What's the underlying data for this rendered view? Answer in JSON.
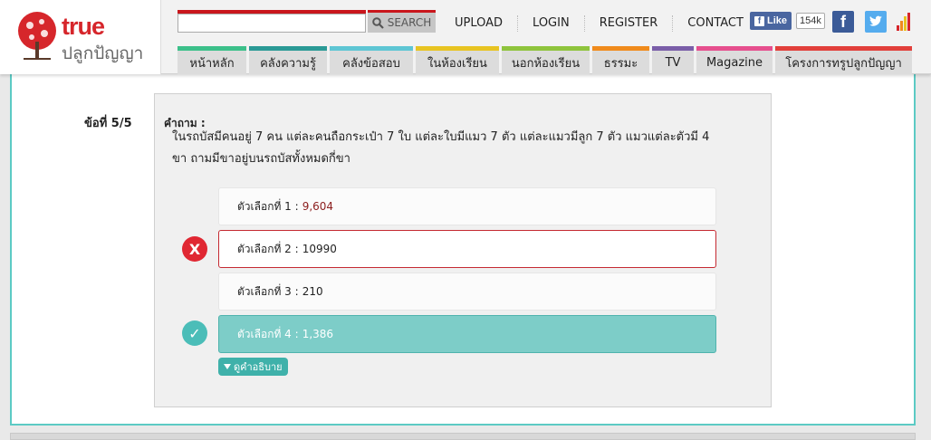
{
  "brand": {
    "name": "true",
    "tagline": "ปลูกปัญญา"
  },
  "search": {
    "placeholder": "",
    "button_label": "SEARCH"
  },
  "toplinks": [
    "UPLOAD",
    "LOGIN",
    "REGISTER",
    "CONTACT"
  ],
  "facebook": {
    "like_label": "Like",
    "like_count": "154k"
  },
  "social": {
    "fb_glyph": "f",
    "tw_glyph": "t"
  },
  "nav": [
    {
      "label": "หน้าหลัก",
      "color": "#3cc08a"
    },
    {
      "label": "คลังความรู้",
      "color": "#2b9a96"
    },
    {
      "label": "คลังข้อสอบ",
      "color": "#5ec6d4"
    },
    {
      "label": "ในห้องเรียน",
      "color": "#e8c422"
    },
    {
      "label": "นอกห้องเรียน",
      "color": "#8fc43d"
    },
    {
      "label": "ธรรมะ",
      "color": "#f08b1d"
    },
    {
      "label": "TV",
      "color": "#7a5ea8"
    },
    {
      "label": "Magazine",
      "color": "#e64f8e"
    },
    {
      "label": "โครงการทรูปลูกปัญญา",
      "color": "#e2403b"
    }
  ],
  "question": {
    "number_label": "ข้อที่ 5/5",
    "label": "คำถาม :",
    "text": "ในรถบัสมีคนอยู่ 7 คน แต่ละคนถือกระเป๋า 7 ใบ แต่ละใบมีแมว 7 ตัว แต่ละแมวมีลูก 7 ตัว แมวแต่ละตัวมี 4 ขา ถามมีขาอยู่บนรถบัสทั้งหมดกี่ขา",
    "choices": [
      {
        "label": "ตัวเลือกที่ 1 :",
        "value": "9,604",
        "state": "normal"
      },
      {
        "label": "ตัวเลือกที่ 2 :",
        "value": "10990",
        "state": "wrong"
      },
      {
        "label": "ตัวเลือกที่ 3 :",
        "value": "210",
        "state": "normal"
      },
      {
        "label": "ตัวเลือกที่ 4 :",
        "value": "1,386",
        "state": "correct"
      }
    ],
    "wrong_glyph": "X",
    "correct_glyph": "✓",
    "explain_label": "ดูคำอธิบาย"
  },
  "colors": {
    "accent": "#5ccac4",
    "brand_red": "#c9161c",
    "correct": "#7dcdc8",
    "wrong": "#c52a32"
  }
}
